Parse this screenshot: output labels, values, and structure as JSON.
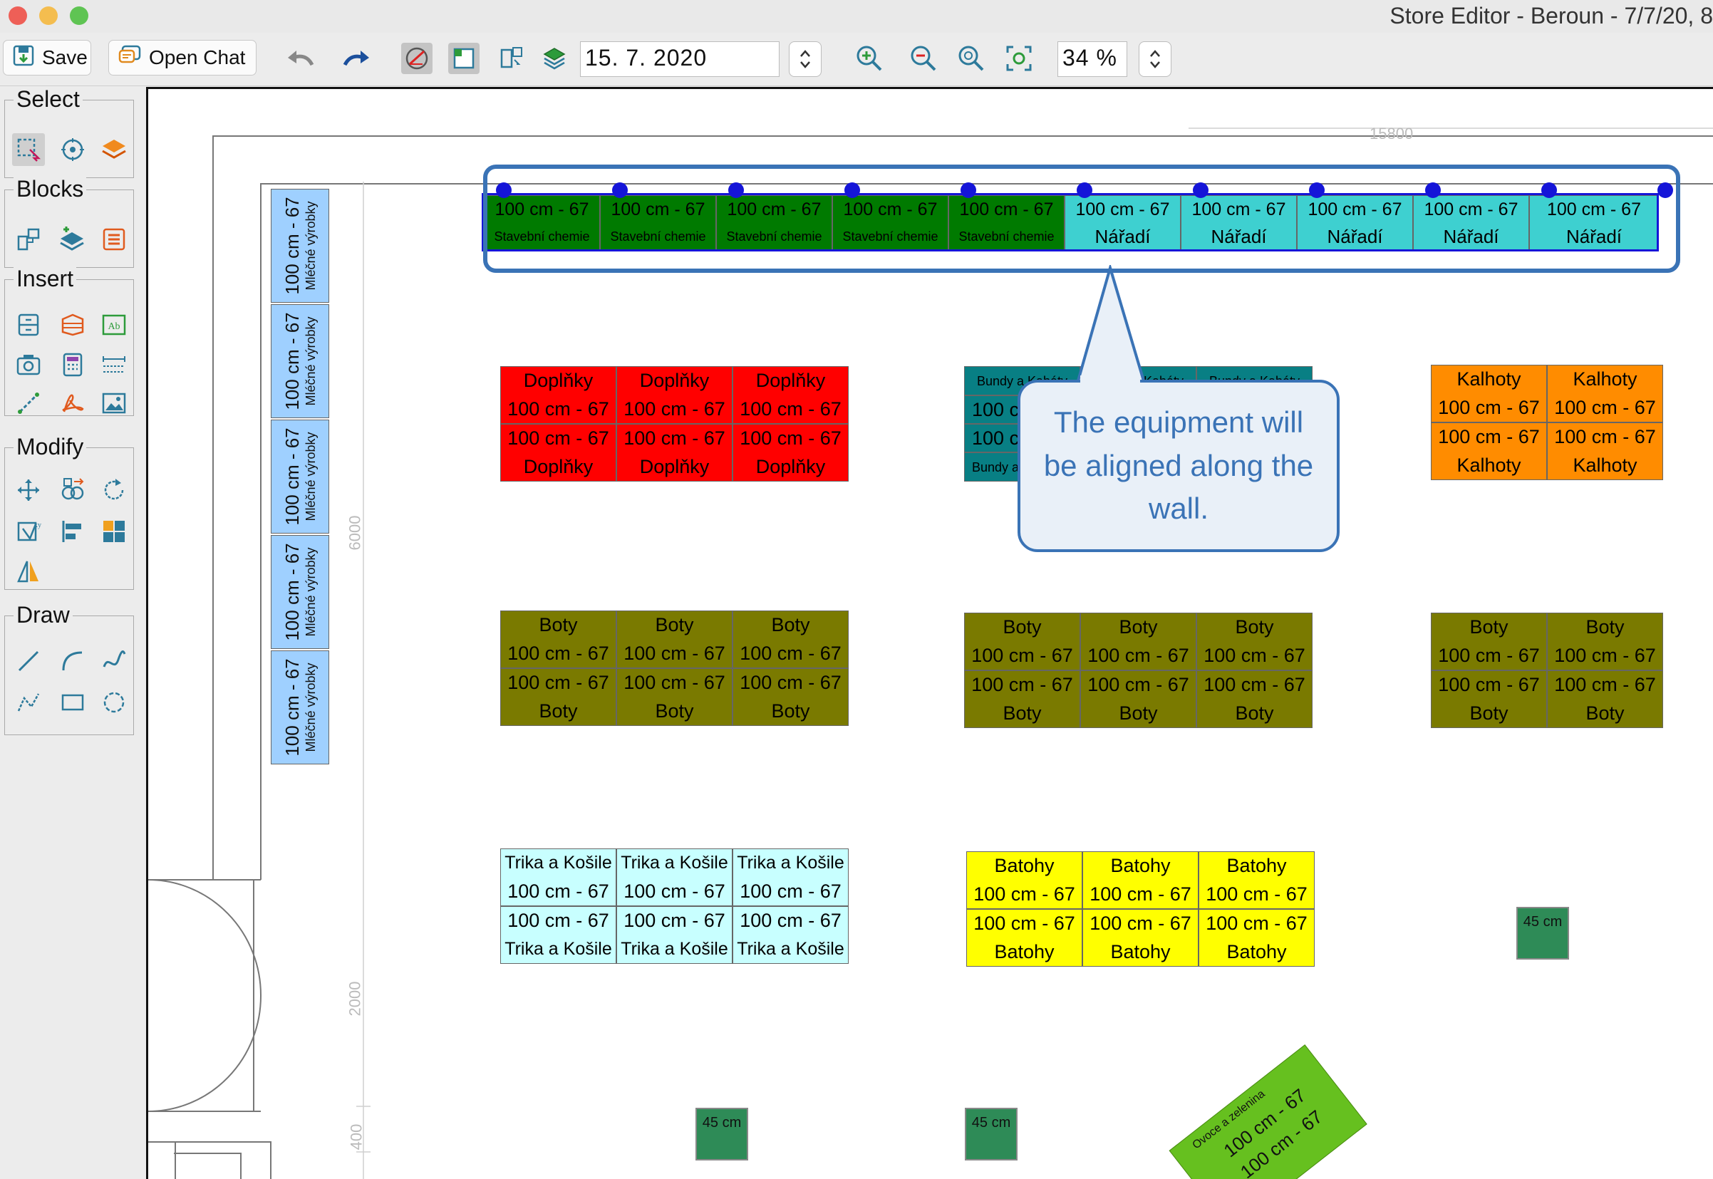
{
  "window": {
    "title": "Store Editor - Beroun - 7/7/20, 8"
  },
  "toolbar": {
    "save_label": "Save",
    "open_chat_label": "Open Chat",
    "date_value": "15. 7. 2020",
    "zoom_value": "34 %"
  },
  "palette": {
    "select_title": "Select",
    "blocks_title": "Blocks",
    "insert_title": "Insert",
    "modify_title": "Modify",
    "draw_title": "Draw"
  },
  "rulers": {
    "top": "15800",
    "left_upper": "6000",
    "left_middle": "2000",
    "left_lower": "400"
  },
  "labels": {
    "size": "100 cm - 67",
    "size_short": "45 cm",
    "dairy": "Mléčné výrobky",
    "chemicals": "Stavební chemie",
    "tools": "Nářadí",
    "accessories": "Doplňky",
    "coats": "Bundy a Kabáty",
    "pants": "Kalhoty",
    "shoes": "Boty",
    "shirts": "Trika a Košile",
    "backpacks": "Batohy",
    "fruit": "Ovoce a zelenina"
  },
  "callout": {
    "text": "The equipment will be aligned along the wall."
  },
  "colors": {
    "chemicals": "#007a00",
    "tools": "#3ed0d0",
    "accessories": "#ff0000",
    "coats": "#087f84",
    "pants": "#ff8c00",
    "shoes": "#7a7a00",
    "shirts": "#c8ffff",
    "backpacks": "#ffff00",
    "dairy": "#9fd0ff",
    "small_unit": "#2e8b57",
    "fruit": "#66c01f",
    "selection": "#3a73b6"
  }
}
